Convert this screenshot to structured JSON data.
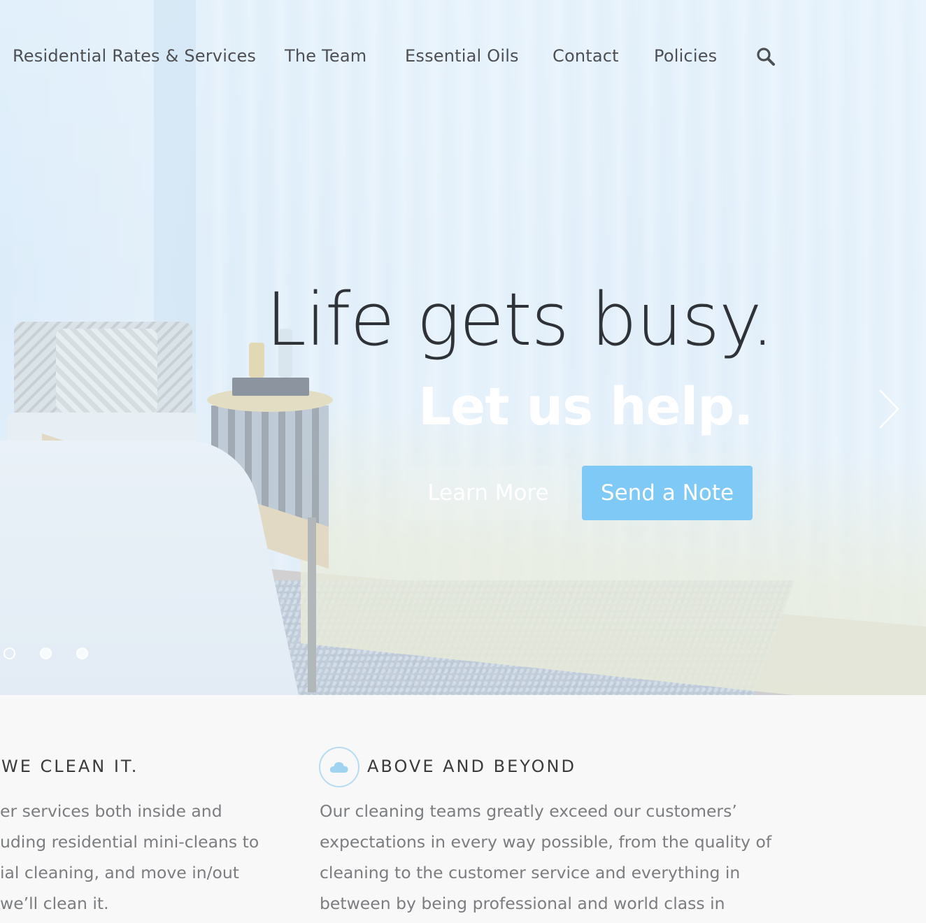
{
  "nav": {
    "items": [
      "Residential Rates & Services",
      "The Team",
      "Essential Oils",
      "Contact",
      "Policies"
    ],
    "search_icon": "search-icon"
  },
  "hero": {
    "headline": "Life gets busy.",
    "subheadline": "Let us help.",
    "learn_more_label": "Learn More",
    "send_note_label": "Send a Note",
    "slide_count": 3,
    "colors": {
      "accent_button": "#7fc9f7",
      "headline": "#2f3236",
      "subheadline": "#ffffff"
    }
  },
  "features": [
    {
      "title": "WE CLEAN IT.",
      "lines": [
        "er services both inside and",
        "uding residential mini-cleans to",
        "ial cleaning, and move in/out",
        "we’ll clean it."
      ]
    },
    {
      "icon": "cloud-icon",
      "title": "ABOVE AND BEYOND",
      "lines": [
        "Our cleaning teams greatly exceed our customers’",
        "expectations in every way possible, from the quality of",
        "cleaning to the customer service and everything in",
        "between by being professional and world class in"
      ]
    }
  ]
}
